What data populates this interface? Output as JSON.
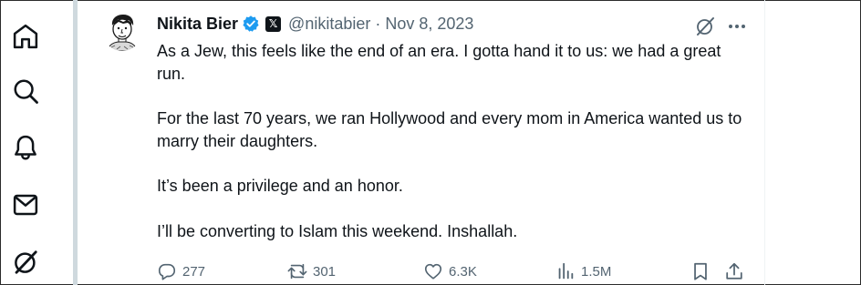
{
  "nav": {
    "items": [
      {
        "icon": "home-icon"
      },
      {
        "icon": "search-icon"
      },
      {
        "icon": "bell-icon"
      },
      {
        "icon": "mail-icon"
      },
      {
        "icon": "grok-icon"
      }
    ]
  },
  "tweet": {
    "author_name": "Nikita Bier",
    "handle": "@nikitabier",
    "separator": "·",
    "date": "Nov 8, 2023",
    "paragraphs": [
      "As a Jew, this feels like the end of an era. I gotta hand it to us: we had a great run.",
      "For the last 70 years, we ran Hollywood and every mom in America wanted us to marry their daughters.",
      "It’s been a privilege and an honor.",
      "I’ll be converting to Islam this weekend. Inshallah."
    ],
    "stats": {
      "replies": "277",
      "reposts": "301",
      "likes": "6.3K",
      "views": "1.5M"
    },
    "colors": {
      "verified": "#1d9bf0",
      "text": "#0f1419",
      "muted": "#536471"
    }
  }
}
